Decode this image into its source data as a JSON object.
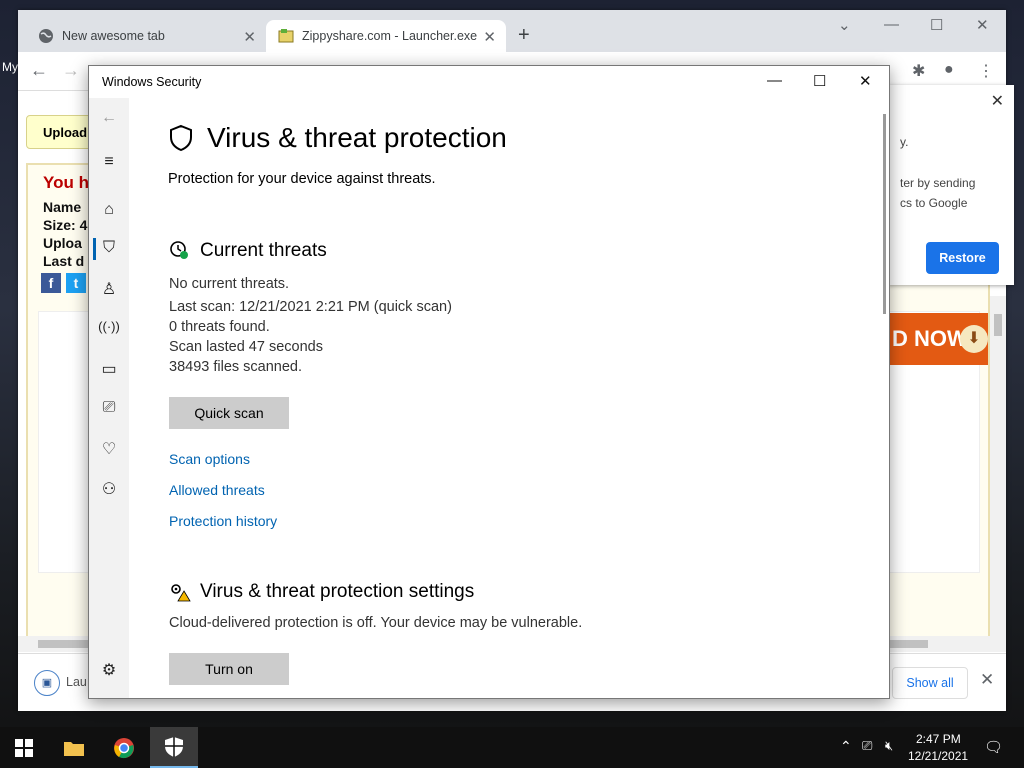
{
  "desktop": {
    "label": "My"
  },
  "browser": {
    "tabs": [
      {
        "title": "New awesome tab",
        "icon": "globe-icon"
      },
      {
        "title": "Zippyshare.com - Launcher.exe",
        "icon": "zippyshare-favicon"
      }
    ],
    "new_tab_symbol": "+",
    "page": {
      "upload_label": "Upload",
      "you_have": "You h",
      "fields": [
        "Name",
        "Size: 4",
        "Uploa",
        "Last d"
      ],
      "social": [
        "f",
        "t"
      ]
    },
    "banner_text": "D NOW",
    "popup": {
      "line1": "y.",
      "line2": "ter by sending",
      "line3": "cs to Google",
      "restore_label": "Restore"
    },
    "downloads": {
      "item_name": "Lau",
      "show_all_label": "Show all"
    }
  },
  "security": {
    "window_title": "Windows Security",
    "heading": "Virus & threat protection",
    "subtitle": "Protection for your device against threats.",
    "current_threats": {
      "title": "Current threats",
      "lines": [
        "No current threats.",
        "Last scan: 12/21/2021 2:21 PM (quick scan)",
        "0 threats found.",
        "Scan lasted 47 seconds",
        "38493 files scanned."
      ],
      "quick_scan_label": "Quick scan",
      "links": [
        "Scan options",
        "Allowed threats",
        "Protection history"
      ]
    },
    "settings": {
      "title": "Virus & threat protection settings",
      "message": "Cloud-delivered protection is off. Your device may be vulnerable.",
      "turn_on_label": "Turn on"
    },
    "nav_icons": [
      "back-icon",
      "menu-icon",
      "home-icon",
      "shield-icon",
      "account-icon",
      "firewall-icon",
      "app-browser-icon",
      "device-security-icon",
      "health-icon",
      "family-icon",
      "settings-icon"
    ]
  },
  "taskbar": {
    "time": "2:47 PM",
    "date": "12/21/2021"
  },
  "colors": {
    "link_blue": "#0063b1",
    "chrome_button_blue": "#1a73e8",
    "nav_active": "#0063b1"
  }
}
